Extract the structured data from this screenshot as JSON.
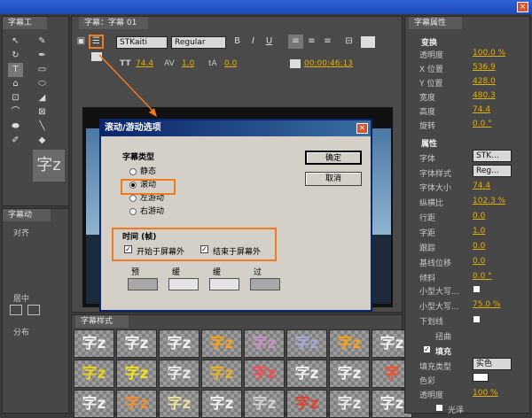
{
  "window": {
    "close": "×"
  },
  "tools": {
    "tab": "字幕工",
    "glyphs": [
      "↖",
      "✎",
      "↻",
      "✒",
      "T",
      "▭",
      "⌂",
      "⬭",
      "⊡",
      "◢",
      "⌒",
      "⊠",
      "⬬",
      "╲",
      "✐",
      "◆"
    ],
    "preview": "字z"
  },
  "roll_tab": {
    "title": "字幕动",
    "align": "对齐",
    "center": "居中",
    "distribute": "分布"
  },
  "title_panel": {
    "tab": "字幕：字幕 01",
    "font": "STKaiti",
    "style": "Regular",
    "size": "74.4",
    "kerning": "1.0",
    "baseline": "0.0",
    "timecode": "00:00:46:13"
  },
  "styles_tab": {
    "title": "字幕样式",
    "glyph": "字z",
    "single": "字"
  },
  "props": {
    "tab": "字幕属性",
    "transform_head": "变换",
    "rows": [
      {
        "label": "透明度",
        "value": "100.0 %"
      },
      {
        "label": "X 位置",
        "value": "536.9"
      },
      {
        "label": "Y 位置",
        "value": "428.0"
      },
      {
        "label": "宽度",
        "value": "480.3"
      },
      {
        "label": "高度",
        "value": "74.4"
      },
      {
        "label": "旋转",
        "value": "0.0 °"
      }
    ],
    "attr_head": "属性",
    "font_label": "字体",
    "font_value": "STK...",
    "style_label": "字体样式",
    "style_value": "Reg...",
    "attr_rows": [
      {
        "label": "字体大小",
        "value": "74.4"
      },
      {
        "label": "纵横比",
        "value": "102.3 %"
      },
      {
        "label": "行距",
        "value": "0.0"
      },
      {
        "label": "字距",
        "value": "1.0"
      },
      {
        "label": "跟踪",
        "value": "0.0"
      },
      {
        "label": "基线位移",
        "value": "0.0"
      },
      {
        "label": "倾斜",
        "value": "0.0 °"
      }
    ],
    "smallcaps": "小型大写...",
    "smallcaps_size_label": "小型大写...",
    "smallcaps_size_value": "75.0 %",
    "underline": "下划线",
    "distort": "扭曲",
    "fill_head": "填充",
    "fill_type_label": "填充类型",
    "fill_type_value": "实色",
    "color_label": "色彩",
    "opacity_label": "透明度",
    "opacity_value": "100 %",
    "gloss": "光泽"
  },
  "dialog": {
    "title": "滚动/游动选项",
    "type_label": "字幕类型",
    "opts": [
      "静态",
      "滚动",
      "左游动",
      "右游动"
    ],
    "time_label": "时间 (帧)",
    "start_off": "开始于屏幕外",
    "end_off": "结束于屏幕外",
    "fields": [
      "预卷",
      "缓入",
      "缓出",
      "过卷"
    ],
    "ok": "确定",
    "cancel": "取消",
    "close": "×"
  },
  "colors": {
    "accent": "#f07a1e",
    "value": "#e5b000",
    "dialog": "#d4d0c8"
  }
}
